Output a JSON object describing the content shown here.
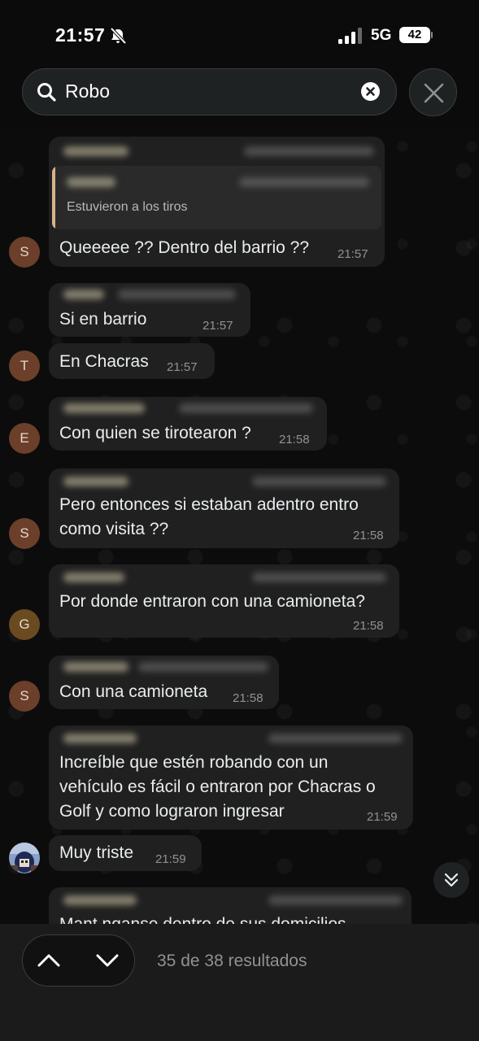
{
  "status_bar": {
    "time": "21:57",
    "network": "5G",
    "battery": "42",
    "icons": [
      "bell-muted-icon",
      "signal-bars-icon",
      "battery-icon"
    ]
  },
  "search": {
    "query": "Robo",
    "icons": [
      "search-icon",
      "clear-icon",
      "close-icon"
    ]
  },
  "messages": [
    {
      "avatar": "S",
      "quote": "Estuvieron a los tiros",
      "text": "Queeeee ?? Dentro del barrio ??",
      "time": "21:57"
    },
    {
      "avatar": "",
      "text": "Si en barrio",
      "time": "21:57"
    },
    {
      "avatar": "T",
      "text": "En Chacras",
      "time": "21:57"
    },
    {
      "avatar": "E",
      "text": "Con quien se tirotearon ?",
      "time": "21:58"
    },
    {
      "avatar": "S",
      "lines": [
        "Pero entonces si estaban adentro entro",
        "como visita ??"
      ],
      "time": "21:58"
    },
    {
      "avatar": "G",
      "text": "Por donde entraron con una camioneta?",
      "time": "21:58"
    },
    {
      "avatar": "S",
      "text": "Con una camioneta",
      "time": "21:58"
    },
    {
      "avatar": "",
      "lines": [
        "Increíble que estén robando con un",
        "vehículo es fácil o entraron por Chacras o",
        "Golf y como lograron ingresar"
      ],
      "time": "21:59"
    },
    {
      "avatar": "photo",
      "text": "Muy triste",
      "time": "21:59"
    },
    {
      "avatar": "",
      "text": "Mant nganse dentro de sus domicilios",
      "time": ""
    }
  ],
  "search_nav": {
    "results": "35 de 38 resultados",
    "icons": [
      "chevron-up-icon",
      "chevron-down-icon",
      "scroll-down-icon"
    ]
  }
}
